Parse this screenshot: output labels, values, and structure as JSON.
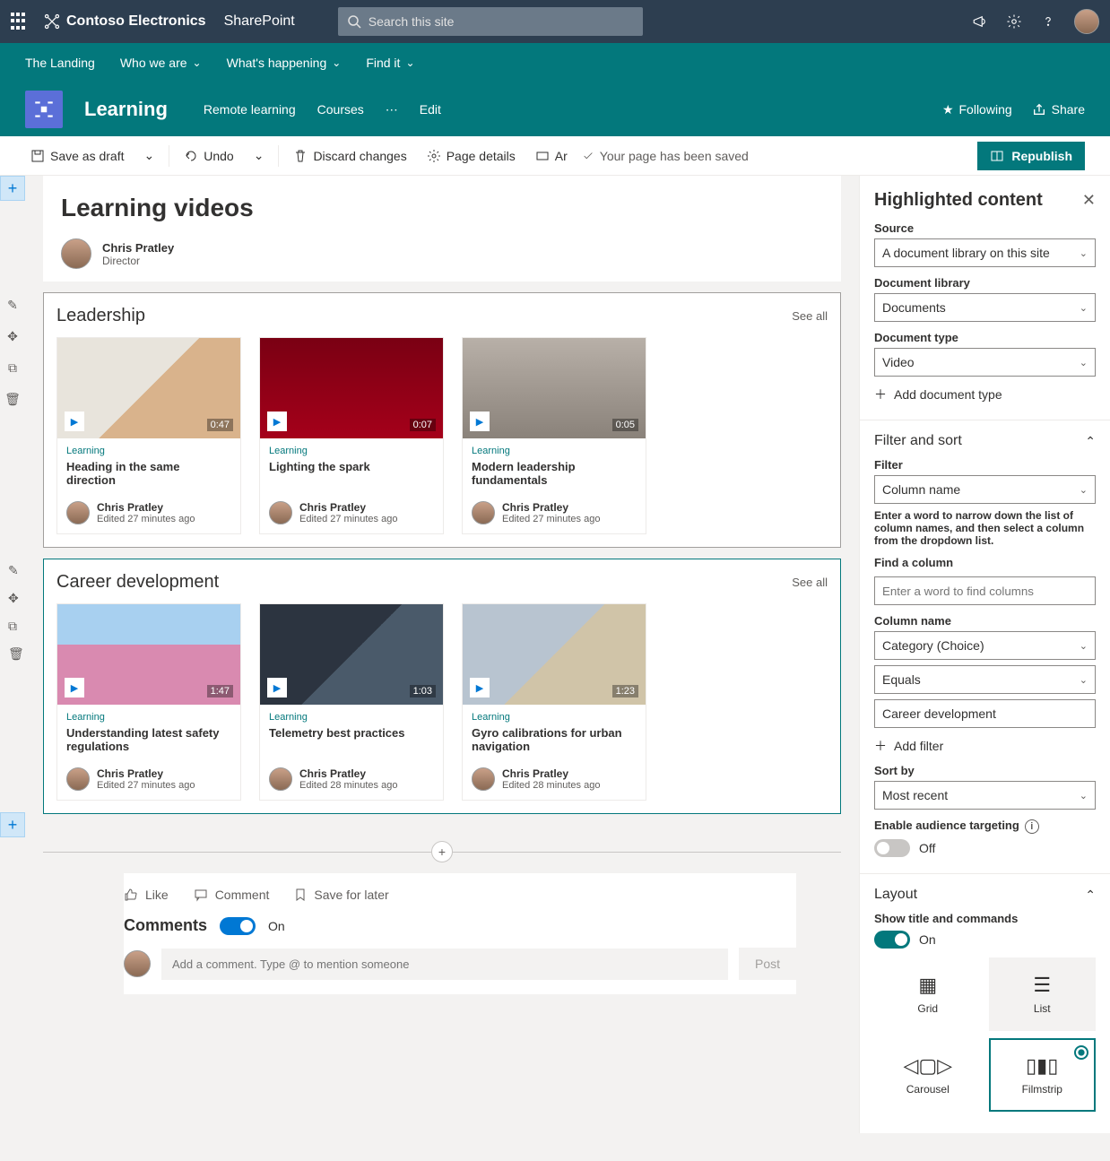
{
  "topbar": {
    "brand": "Contoso Electronics",
    "product": "SharePoint",
    "search_placeholder": "Search this site"
  },
  "nav": {
    "landing": "The Landing",
    "who": "Who we are",
    "what": "What's happening",
    "find": "Find it"
  },
  "hub": {
    "title": "Learning",
    "links": [
      "Remote learning",
      "Courses",
      "⋯",
      "Edit"
    ],
    "follow": "Following",
    "share": "Share"
  },
  "cmdbar": {
    "save": "Save as draft",
    "undo": "Undo",
    "discard": "Discard changes",
    "details": "Page details",
    "ar": "Ar",
    "saved": "Your page has been saved",
    "republish": "Republish"
  },
  "page": {
    "title": "Learning videos",
    "author": "Chris Pratley",
    "role": "Director"
  },
  "sections": [
    {
      "title": "Leadership",
      "see_all": "See all",
      "cards": [
        {
          "cat": "Learning",
          "title": "Heading in the same direction",
          "dur": "0:47",
          "user": "Chris Pratley",
          "edited": "Edited 27 minutes ago",
          "thumbclass": "t1"
        },
        {
          "cat": "Learning",
          "title": "Lighting the spark",
          "dur": "0:07",
          "user": "Chris Pratley",
          "edited": "Edited 27 minutes ago",
          "thumbclass": "t2"
        },
        {
          "cat": "Learning",
          "title": "Modern leadership fundamentals",
          "dur": "0:05",
          "user": "Chris Pratley",
          "edited": "Edited 27 minutes ago",
          "thumbclass": "t3"
        }
      ]
    },
    {
      "title": "Career development",
      "see_all": "See all",
      "cards": [
        {
          "cat": "Learning",
          "title": "Understanding latest safety regulations",
          "dur": "1:47",
          "user": "Chris Pratley",
          "edited": "Edited 27 minutes ago",
          "thumbclass": "t4"
        },
        {
          "cat": "Learning",
          "title": "Telemetry best practices",
          "dur": "1:03",
          "user": "Chris Pratley",
          "edited": "Edited 28 minutes ago",
          "thumbclass": "t5"
        },
        {
          "cat": "Learning",
          "title": "Gyro calibrations for urban navigation",
          "dur": "1:23",
          "user": "Chris Pratley",
          "edited": "Edited 28 minutes ago",
          "thumbclass": "t6"
        }
      ]
    }
  ],
  "engage": {
    "like": "Like",
    "comment": "Comment",
    "save": "Save for later",
    "comments": "Comments",
    "on": "On",
    "placeholder": "Add a comment. Type @ to mention someone",
    "post": "Post"
  },
  "panel": {
    "title": "Highlighted content",
    "source_lbl": "Source",
    "source_val": "A document library on this site",
    "doclib_lbl": "Document library",
    "doclib_val": "Documents",
    "doctype_lbl": "Document type",
    "doctype_val": "Video",
    "add_doctype": "Add document type",
    "filter_sort": "Filter and sort",
    "filter_lbl": "Filter",
    "filter_val": "Column name",
    "filter_hint": "Enter a word to narrow down the list of column names, and then select a column from the dropdown list.",
    "find_col_lbl": "Find a column",
    "find_col_ph": "Enter a word to find columns",
    "colname_lbl": "Column name",
    "colname_val": "Category (Choice)",
    "op_val": "Equals",
    "val_val": "Career development",
    "add_filter": "Add filter",
    "sort_lbl": "Sort by",
    "sort_val": "Most recent",
    "aud_lbl": "Enable audience targeting",
    "aud_state": "Off",
    "layout": "Layout",
    "show_title_lbl": "Show title and commands",
    "show_title_state": "On",
    "layouts": {
      "grid": "Grid",
      "list": "List",
      "carousel": "Carousel",
      "filmstrip": "Filmstrip"
    }
  }
}
